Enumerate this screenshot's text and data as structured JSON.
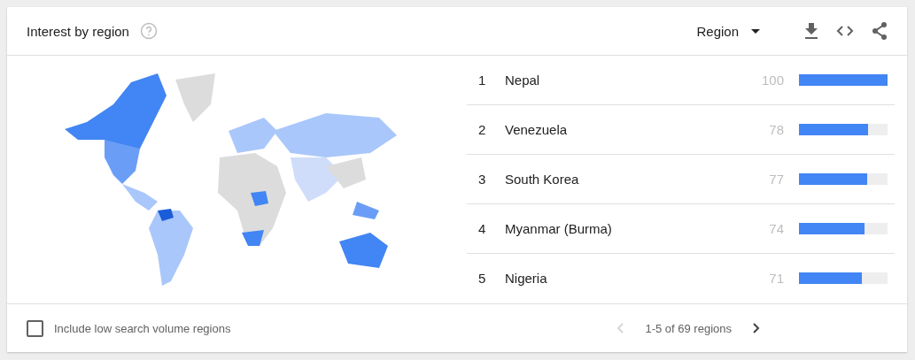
{
  "header": {
    "title": "Interest by region",
    "dropdown": {
      "value": "Region"
    }
  },
  "rows": [
    {
      "rank": "1",
      "name": "Nepal",
      "value": "100",
      "level": 1.0
    },
    {
      "rank": "2",
      "name": "Venezuela",
      "value": "78",
      "level": 0.78
    },
    {
      "rank": "3",
      "name": "South Korea",
      "value": "77",
      "level": 0.77
    },
    {
      "rank": "4",
      "name": "Myanmar (Burma)",
      "value": "74",
      "level": 0.74
    },
    {
      "rank": "5",
      "name": "Nigeria",
      "value": "71",
      "level": 0.71
    }
  ],
  "footer": {
    "checkbox": {
      "label": "Include low search volume regions",
      "checked": false
    },
    "pagination": {
      "label": "1-5 of 69 regions",
      "prev_disabled": true,
      "next_disabled": false
    }
  }
}
